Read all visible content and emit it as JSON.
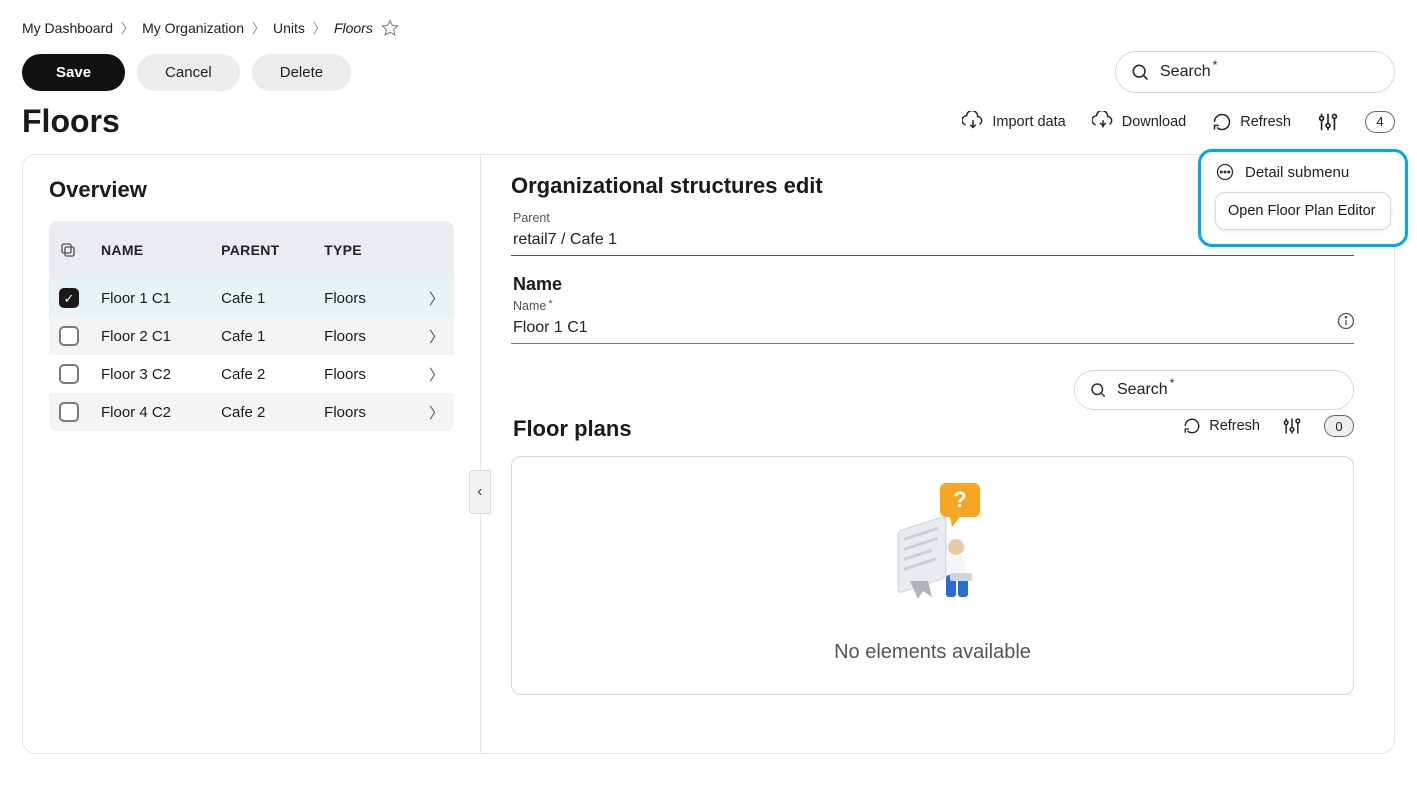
{
  "breadcrumb": {
    "items": [
      "My Dashboard",
      "My Organization",
      "Units",
      "Floors"
    ]
  },
  "actions": {
    "save": "Save",
    "cancel": "Cancel",
    "delete": "Delete"
  },
  "search": {
    "label": "Search",
    "placeholder": ""
  },
  "page_title": "Floors",
  "toolbar": {
    "import": "Import data",
    "download": "Download",
    "refresh": "Refresh",
    "count": "4"
  },
  "overview": {
    "title": "Overview",
    "columns": {
      "name": "NAME",
      "parent": "PARENT",
      "type": "TYPE"
    },
    "rows": [
      {
        "checked": true,
        "name": "Floor 1 C1",
        "parent": "Cafe 1",
        "type": "Floors"
      },
      {
        "checked": false,
        "name": "Floor 2 C1",
        "parent": "Cafe 1",
        "type": "Floors"
      },
      {
        "checked": false,
        "name": "Floor 3 C2",
        "parent": "Cafe 2",
        "type": "Floors"
      },
      {
        "checked": false,
        "name": "Floor 4 C2",
        "parent": "Cafe 2",
        "type": "Floors"
      }
    ]
  },
  "editor": {
    "title": "Organizational structures edit",
    "parent_label": "Parent",
    "parent_value": "retail7 / Cafe 1",
    "name_section": "Name",
    "name_label": "Name",
    "name_value": "Floor 1 C1"
  },
  "submenu": {
    "header": "Detail submenu",
    "item": "Open Floor Plan Editor"
  },
  "inner_search": {
    "label": "Search"
  },
  "floorplans": {
    "title": "Floor plans",
    "refresh": "Refresh",
    "count": "0",
    "empty_msg": "No elements available"
  }
}
